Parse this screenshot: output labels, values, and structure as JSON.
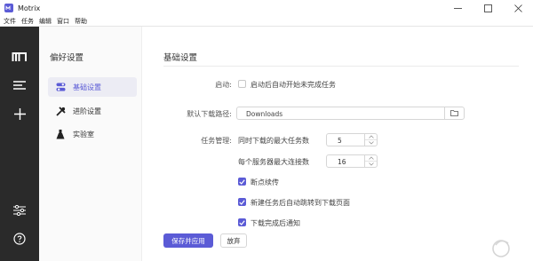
{
  "window": {
    "title": "Motrix",
    "controls": [
      "minimize",
      "maximize",
      "close"
    ]
  },
  "menu": [
    "文件",
    "任务",
    "编辑",
    "窗口",
    "帮助"
  ],
  "aside": {
    "icons": [
      "motrix-logo-icon",
      "menu-list-icon",
      "add-icon",
      "settings-sliders-icon",
      "help-icon"
    ]
  },
  "subnav": {
    "title": "偏好设置",
    "items": [
      {
        "label": "基础设置",
        "icon": "toggle-icon",
        "active": true
      },
      {
        "label": "进阶设置",
        "icon": "tools-icon",
        "active": false
      },
      {
        "label": "实验室",
        "icon": "flask-icon",
        "active": false
      }
    ]
  },
  "main": {
    "section_title": "基础设置",
    "startup": {
      "label": "启动:",
      "checkbox_label": "启动后自动开始未完成任务",
      "checked": false
    },
    "download_path": {
      "label": "默认下载路径:",
      "value": "Downloads"
    },
    "task_mgmt": {
      "label": "任务管理:",
      "max_tasks_label": "同时下载的最大任务数",
      "max_tasks_value": "5",
      "max_conn_label": "每个服务器最大连接数",
      "max_conn_value": "16",
      "options": [
        {
          "label": "断点续传",
          "checked": true
        },
        {
          "label": "新建任务后自动跳转到下载页面",
          "checked": true
        },
        {
          "label": "下载完成后通知",
          "checked": true
        }
      ]
    },
    "buttons": {
      "save": "保存并应用",
      "discard": "放弃"
    }
  },
  "colors": {
    "accent": "#5b5bd6",
    "aside_bg": "#2a2a2a",
    "subnav_bg": "#fafafa"
  }
}
